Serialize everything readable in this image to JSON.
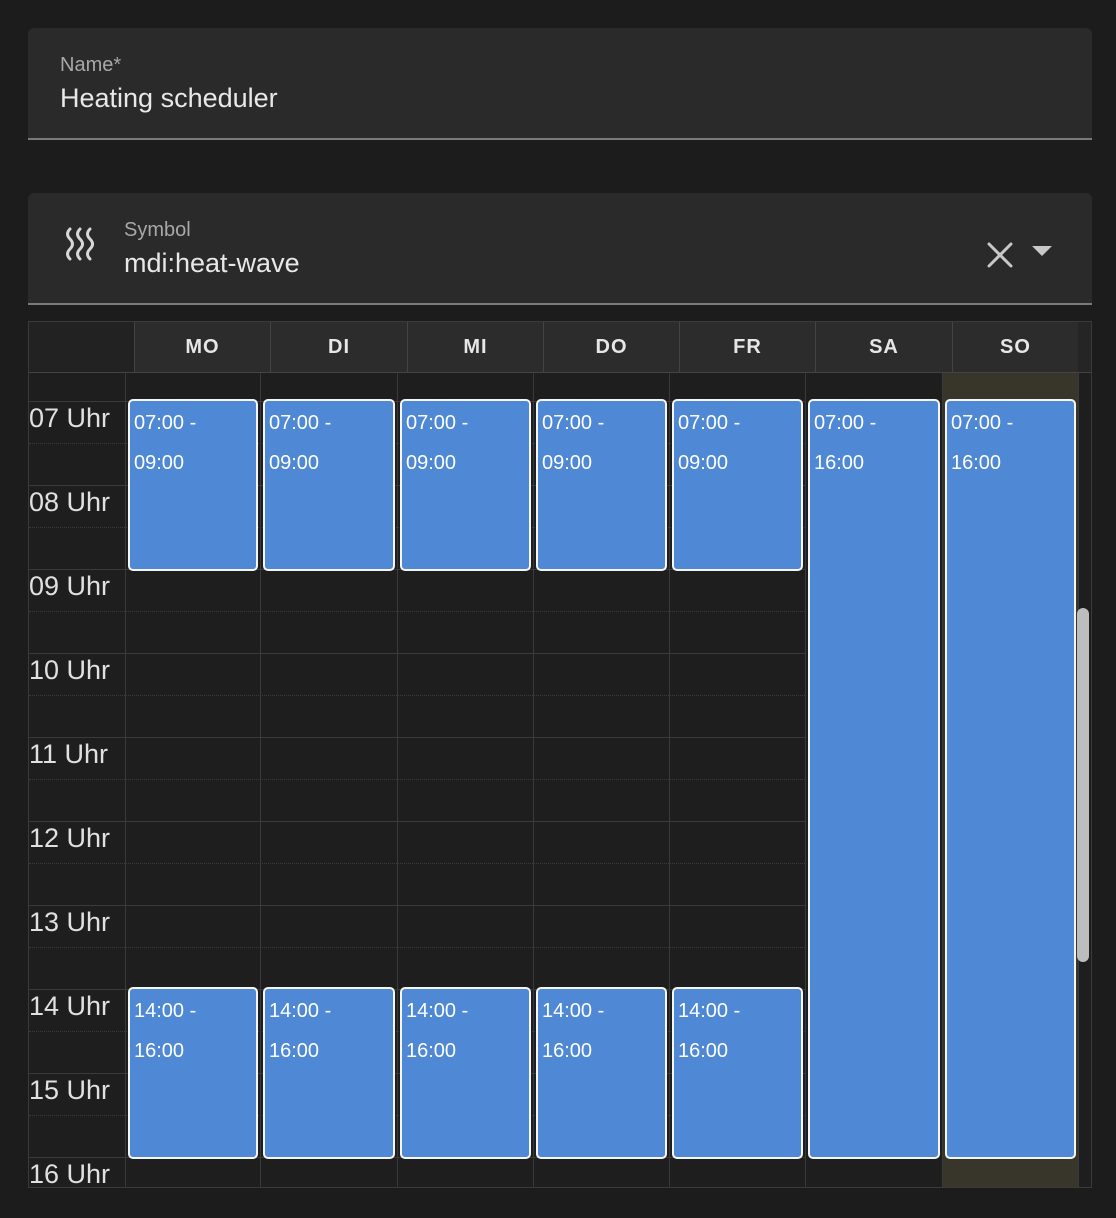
{
  "name_field": {
    "label": "Name*",
    "value": "Heating scheduler"
  },
  "symbol_field": {
    "label": "Symbol",
    "value": "mdi:heat-wave",
    "icon": "heat-wave-icon"
  },
  "calendar": {
    "days": [
      "MO",
      "DI",
      "MI",
      "DO",
      "FR",
      "SA",
      "SO"
    ],
    "hours": [
      "07 Uhr",
      "08 Uhr",
      "09 Uhr",
      "10 Uhr",
      "11 Uhr",
      "12 Uhr",
      "13 Uhr",
      "14 Uhr",
      "15 Uhr",
      "16 Uhr"
    ],
    "today": "SO",
    "events": [
      {
        "day": "MO",
        "start": "07:00",
        "end": "09:00",
        "line1": "07:00 -",
        "line2": "09:00"
      },
      {
        "day": "DI",
        "start": "07:00",
        "end": "09:00",
        "line1": "07:00 -",
        "line2": "09:00"
      },
      {
        "day": "MI",
        "start": "07:00",
        "end": "09:00",
        "line1": "07:00 -",
        "line2": "09:00"
      },
      {
        "day": "DO",
        "start": "07:00",
        "end": "09:00",
        "line1": "07:00 -",
        "line2": "09:00"
      },
      {
        "day": "FR",
        "start": "07:00",
        "end": "09:00",
        "line1": "07:00 -",
        "line2": "09:00"
      },
      {
        "day": "SA",
        "start": "07:00",
        "end": "16:00",
        "line1": "07:00 -",
        "line2": "16:00"
      },
      {
        "day": "SO",
        "start": "07:00",
        "end": "16:00",
        "line1": "07:00 -",
        "line2": "16:00"
      },
      {
        "day": "MO",
        "start": "14:00",
        "end": "16:00",
        "line1": "14:00 -",
        "line2": "16:00"
      },
      {
        "day": "DI",
        "start": "14:00",
        "end": "16:00",
        "line1": "14:00 -",
        "line2": "16:00"
      },
      {
        "day": "MI",
        "start": "14:00",
        "end": "16:00",
        "line1": "14:00 -",
        "line2": "16:00"
      },
      {
        "day": "DO",
        "start": "14:00",
        "end": "16:00",
        "line1": "14:00 -",
        "line2": "16:00"
      },
      {
        "day": "FR",
        "start": "14:00",
        "end": "16:00",
        "line1": "14:00 -",
        "line2": "16:00"
      }
    ]
  },
  "colors": {
    "event": "#4f88d4",
    "today": "#38362a"
  }
}
